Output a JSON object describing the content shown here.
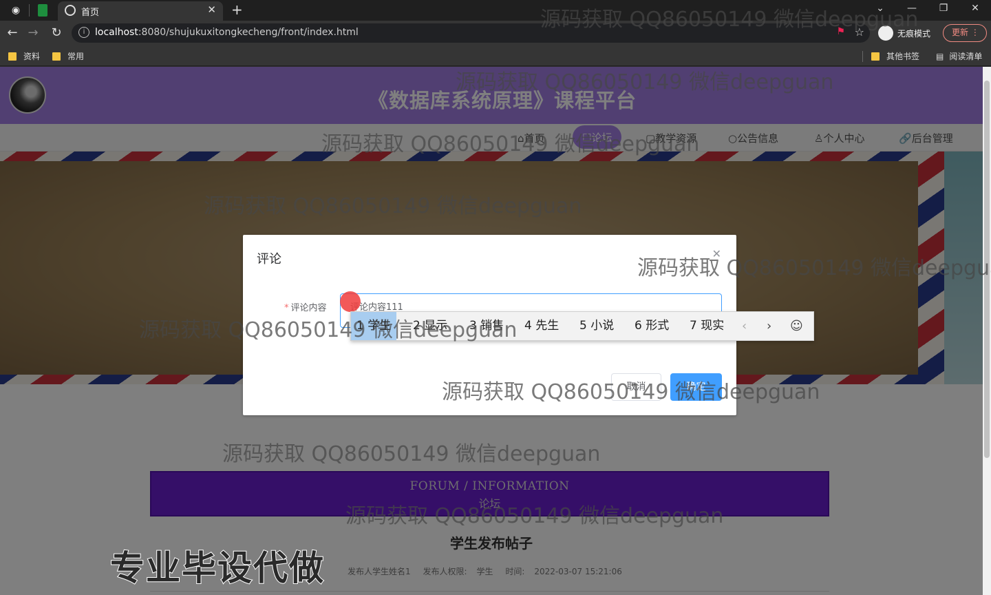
{
  "browser": {
    "tab_title": "首页",
    "url_host": "localhost",
    "url_rest": ":8080/shujukuxitongkecheng/front/index.html",
    "incognito_label": "无痕模式",
    "update_label": "更新",
    "bookmarks": [
      "资料",
      "常用"
    ],
    "bookmarks_right": [
      "其他书签",
      "阅读清单"
    ]
  },
  "site": {
    "title": "《数据库系统原理》课程平台",
    "nav": [
      "首页",
      "论坛",
      "教学资源",
      "公告信息",
      "个人中心",
      "后台管理"
    ],
    "nav_icons": [
      "home-icon",
      "chat-icon",
      "doc-icon",
      "notice-icon",
      "user-icon",
      "link-icon"
    ],
    "active_nav": "论坛"
  },
  "forum": {
    "heading_en": "FORUM / INFORMATION",
    "heading_cn": "论坛",
    "post_title": "学生发布帖子",
    "meta_author": "发布人学生姓名1",
    "meta_role_label": "发布人权限:",
    "meta_role": "学生",
    "meta_time_label": "时间:",
    "meta_time": "2022-03-07 15:21:06"
  },
  "dialog": {
    "title": "评论",
    "field_label": "评论内容",
    "field_value": "评论内容111",
    "cancel_label": "取消",
    "confirm_label": "确定"
  },
  "ime": {
    "candidates": [
      "1 学生",
      "2 显示",
      "3 销售",
      "4 先生",
      "5 小说",
      "6 形式",
      "7 现实"
    ],
    "selected_index": 0
  },
  "overlay_text": {
    "watermark": "源码获取 QQ86050149 微信deepguan",
    "promo": "专业毕设代做"
  },
  "colors": {
    "header_purple": "#a37fe5",
    "forum_bar": "#6a1fd1",
    "primary_button": "#409eff"
  }
}
